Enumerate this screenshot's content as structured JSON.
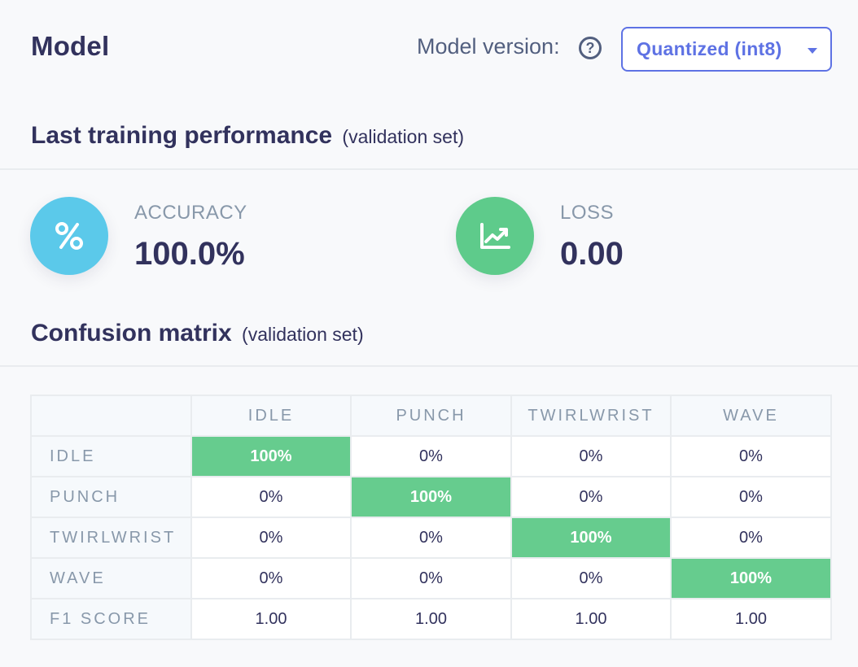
{
  "header": {
    "title": "Model",
    "version_label": "Model version:",
    "help_icon": "?",
    "version_selected": "Quantized (int8)"
  },
  "performance": {
    "heading": "Last training performance",
    "subheading": "(validation set)",
    "accuracy": {
      "label": "ACCURACY",
      "value": "100.0%",
      "icon": "percent-icon",
      "color": "#5bc9ea"
    },
    "loss": {
      "label": "LOSS",
      "value": "0.00",
      "icon": "trending-chart-icon",
      "color": "#5ecb8b"
    }
  },
  "confusion": {
    "heading": "Confusion matrix",
    "subheading": "(validation set)",
    "columns": [
      "IDLE",
      "PUNCH",
      "TWIRLWRIST",
      "WAVE"
    ],
    "rows": [
      {
        "label": "IDLE",
        "cells": [
          "100%",
          "0%",
          "0%",
          "0%"
        ]
      },
      {
        "label": "PUNCH",
        "cells": [
          "0%",
          "100%",
          "0%",
          "0%"
        ]
      },
      {
        "label": "TWIRLWRIST",
        "cells": [
          "0%",
          "0%",
          "100%",
          "0%"
        ]
      },
      {
        "label": "WAVE",
        "cells": [
          "0%",
          "0%",
          "0%",
          "100%"
        ]
      }
    ],
    "f1": {
      "label": "F1 SCORE",
      "cells": [
        "1.00",
        "1.00",
        "1.00",
        "1.00"
      ]
    },
    "highlight_color": "#66cc8e"
  }
}
